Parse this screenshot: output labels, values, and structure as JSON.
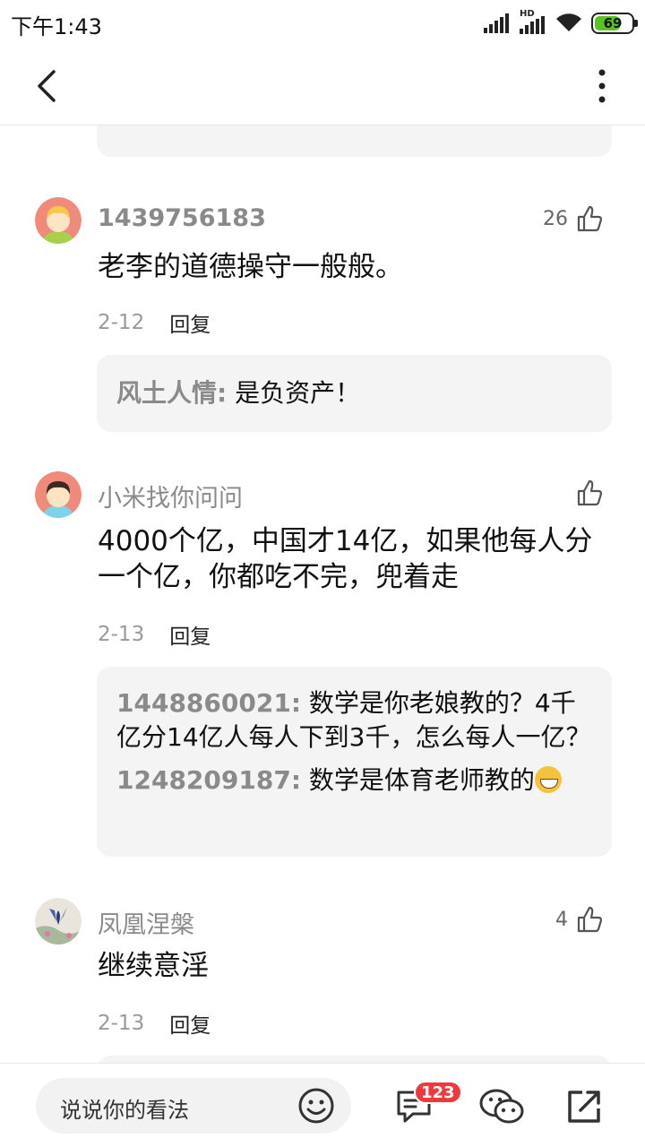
{
  "status_bar": {
    "time": "下午1:43",
    "battery": "69",
    "battery_percent": 69,
    "network_label": "HD"
  },
  "comments": [
    {
      "author": "1439756183",
      "likes": "26",
      "text": "老李的道德操守一般般。",
      "date": "2-12",
      "reply_label": "回复",
      "replies": [
        {
          "user": "风土人情:",
          "text": " 是负资产！"
        }
      ]
    },
    {
      "author": "小米找你问问",
      "likes": "",
      "text": "4000个亿，中国才14亿，如果他每人分一个亿，你都吃不完，兜着走",
      "date": "2-13",
      "reply_label": "回复",
      "replies": [
        {
          "user": "1448860021:",
          "text": " 数学是你老娘教的？4千亿分14亿人每人下到3千，怎么每人一亿？"
        },
        {
          "user": "1248209187:",
          "text": " 数学是体育老师教的"
        }
      ]
    },
    {
      "author": "凤凰涅槃",
      "likes": "4",
      "text": "继续意淫",
      "date": "2-13",
      "reply_label": "回复",
      "replies": []
    }
  ],
  "bottom_bar": {
    "placeholder": "说说你的看法",
    "comment_count": "123"
  },
  "colors": {
    "badge": "#f0383f",
    "battery": "#58c322",
    "reply_bg": "#f4f4f4"
  }
}
